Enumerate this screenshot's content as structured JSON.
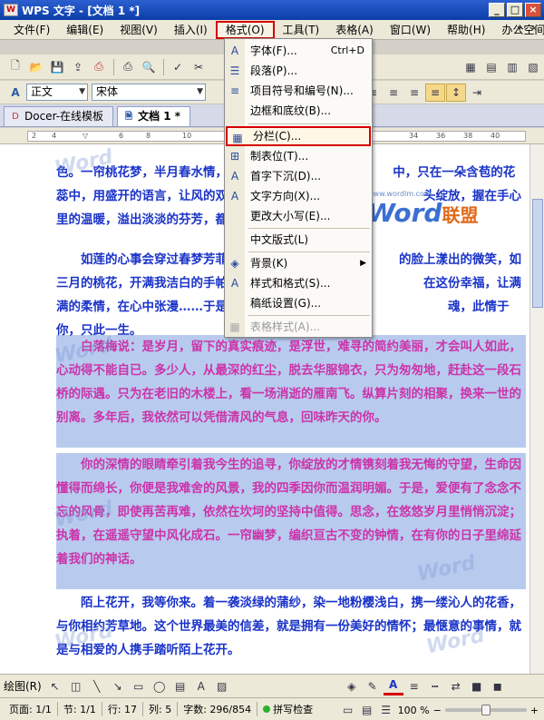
{
  "window": {
    "title": "WPS 文字 - [文档 1 *]",
    "app_icon": "W"
  },
  "menubar": {
    "items": [
      "文件(F)",
      "编辑(E)",
      "视图(V)",
      "插入(I)",
      "格式(O)",
      "工具(T)",
      "表格(A)",
      "窗口(W)",
      "帮助(H)",
      "办公空间(K)"
    ],
    "active_index": 4
  },
  "format_toolbar": {
    "style": "正文",
    "font": "宋体"
  },
  "tabs": [
    {
      "label": "Docer-在线模板",
      "active": false
    },
    {
      "label": "文档 1 *",
      "active": true
    }
  ],
  "format_menu": {
    "items": [
      {
        "label": "字体(F)...",
        "shortcut": "Ctrl+D",
        "icon": "font-icon",
        "glyph": "A"
      },
      {
        "label": "段落(P)...",
        "icon": "paragraph-icon",
        "glyph": "☰"
      },
      {
        "label": "项目符号和编号(N)...",
        "icon": "bullets-icon",
        "glyph": "≡"
      },
      {
        "label": "边框和底纹(B)...",
        "icon": "",
        "glyph": ""
      },
      {
        "label": "分栏(C)...",
        "icon": "columns-icon",
        "glyph": "▦",
        "selected": true
      },
      {
        "label": "制表位(T)...",
        "icon": "tab-stops-icon",
        "glyph": "⊞"
      },
      {
        "label": "首字下沉(D)...",
        "icon": "drop-cap-icon",
        "glyph": "A"
      },
      {
        "label": "文字方向(X)...",
        "icon": "text-direction-icon",
        "glyph": "A"
      },
      {
        "label": "更改大小写(E)...",
        "icon": "",
        "glyph": ""
      },
      {
        "label": "中文版式(L)",
        "icon": "",
        "glyph": ""
      },
      {
        "label": "背景(K)",
        "icon": "background-icon",
        "glyph": "◈",
        "submenu": true
      },
      {
        "label": "样式和格式(S)...",
        "icon": "styles-icon",
        "glyph": "A"
      },
      {
        "label": "稿纸设置(G)...",
        "icon": "",
        "glyph": ""
      },
      {
        "label": "表格样式(A)...",
        "icon": "table-style-icon",
        "glyph": "▦",
        "disabled": true
      }
    ]
  },
  "document": {
    "paragraphs": [
      {
        "text": "色。一帘桃花梦，半月春水情，　　　　　　　　　　　　　　中，只在一朵含苞的花蕊中，用盛开的语言，让风的双手，托　　　　　　　　　　　　　头绽放，握在手心里的温暖，溢出淡淡的芬芳，都成独一无二",
        "color": "blue",
        "highlight": false
      },
      {
        "text": "　　如莲的心事会穿过春梦芳菲　　　　　　　　　　　　　　的脸上漾出的微笑，如三月的桃花，开满我洁白的手帕，沿思　　　　　　　　　　　　　在这份幸福，让满满的柔情，在心中张漫……于是，心便在如　　　　　　　　　　　　　魂，此情于你，只此一生。",
        "color": "blue",
        "highlight": false
      },
      {
        "text": "　　白落梅说：是岁月，留下的真实痕迹，是浮世，难寻的简约美丽，才会叫人如此，心动得不能自已。多少人，从最深的红尘，脱去华服锦衣，只为匆匆地，赶赴这一段石桥的际遇。只为在老旧的木楼上，看一场消逝的雁南飞。纵算片刻的相聚，换来一世的别离。多年后，我依然可以凭借清风的气息，回味昨天的你。",
        "color": "pink",
        "highlight": true
      },
      {
        "text": "　　你的深情的眼睛牵引着我今生的追寻，你绽放的才情镌刻着我无悔的守望，生命因懂得而绵长，你便是我难舍的风景，我的四季因你而温润明媚。于是，爱便有了念念不忘的风骨，即使再苦再难，依然在坎坷的坚持中值得。思念，在悠悠岁月里悄悄沉淀；执着，在遥遥守望中风化成石。一帘幽梦，编织亘古不变的钟情，在有你的日子里绵延着我们的神话。",
        "color": "pink",
        "highlight": true
      },
      {
        "text": "　　陌上花开，我等你来。着一袭淡绿的蒲纱，染一地粉樱浅白，携一缕沁人的花香，与你相约芳草地。这个世界最美的信差，就是拥有一份美好的情怀；最惬意的事情，就是与相爱的人携手踏听陌上花开。",
        "color": "blue",
        "highlight": false
      }
    ],
    "watermark_url": "www.wordlm.com",
    "watermark_word": "Word",
    "watermark_cn": "联盟"
  },
  "drawing_toolbar": {
    "label": "绘图(R)"
  },
  "statusbar": {
    "page": "页面: 1/1",
    "section": "节: 1/1",
    "line": "行: 17",
    "column": "列: 5",
    "wordcount": "字数: 296/854",
    "spellcheck": "拼写检查",
    "zoom": "100 %",
    "zoom_level": 0.5
  },
  "colors": {
    "blue_text": "#1a33c8",
    "pink_text": "#cc33aa",
    "highlight": "#b8cbee",
    "title_bar": "#0b3ea8",
    "callout_red": "#d40000"
  }
}
